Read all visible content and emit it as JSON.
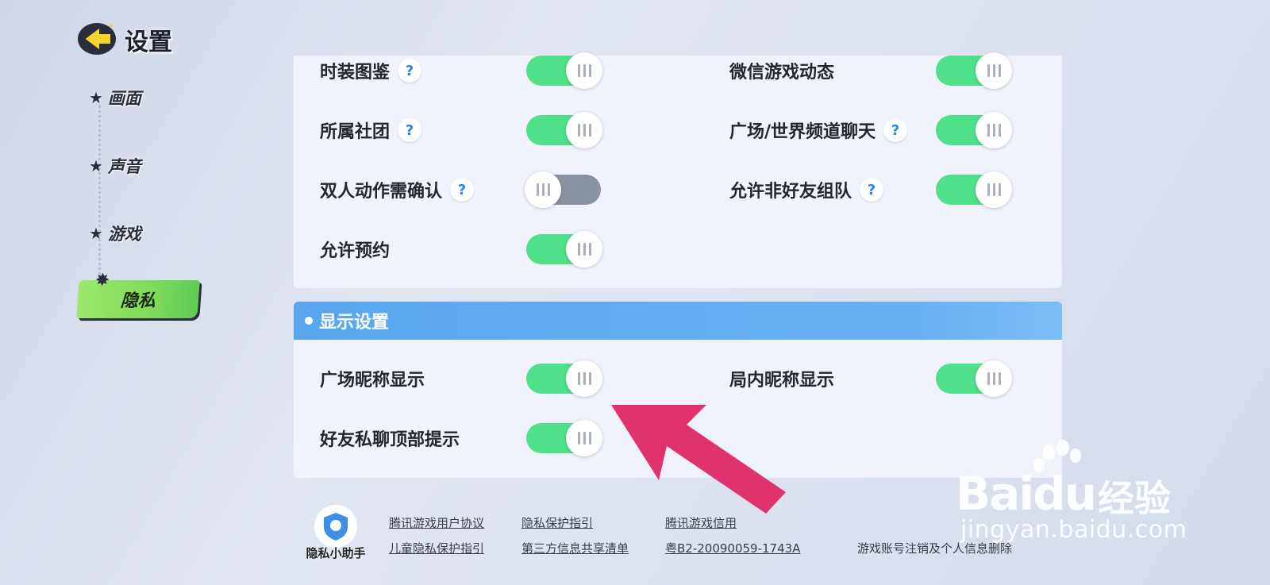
{
  "header": {
    "title": "设置"
  },
  "sidebar": {
    "items": [
      {
        "label": "画面"
      },
      {
        "label": "声音"
      },
      {
        "label": "游戏"
      },
      {
        "label": "隐私",
        "active": true
      }
    ]
  },
  "privacy": {
    "rows": [
      {
        "label": "时装图鉴",
        "help": true,
        "on": true
      },
      {
        "label": "微信游戏动态",
        "help": false,
        "on": true
      },
      {
        "label": "所属社团",
        "help": true,
        "on": true
      },
      {
        "label": "广场/世界频道聊天",
        "help": true,
        "on": true
      },
      {
        "label": "双人动作需确认",
        "help": true,
        "on": false
      },
      {
        "label": "允许非好友组队",
        "help": true,
        "on": true
      },
      {
        "label": "允许预约",
        "help": false,
        "on": true
      }
    ]
  },
  "display": {
    "title": "显示设置",
    "rows": [
      {
        "label": "广场昵称显示",
        "on": true
      },
      {
        "label": "局内昵称显示",
        "on": true
      },
      {
        "label": "好友私聊顶部提示",
        "on": true
      }
    ]
  },
  "footer": {
    "assistant_label": "隐私小助手",
    "links": [
      "腾讯游戏用户协议",
      "隐私保护指引",
      "腾讯游戏信用",
      "儿童隐私保护指引",
      "第三方信息共享清单",
      "粤B2-20090059-1743A",
      "游戏账号注销及个人信息删除"
    ]
  },
  "help_glyph": "?",
  "watermark": {
    "brand": "Baidu",
    "cn": "经验",
    "url": "jingyan.baidu.com"
  },
  "colors": {
    "toggle_on": "#4fe08a",
    "toggle_off": "#8a93a4",
    "section_header": "#5aa6ee",
    "nav_active": "#8ee263",
    "arrow": "#e0336e"
  }
}
